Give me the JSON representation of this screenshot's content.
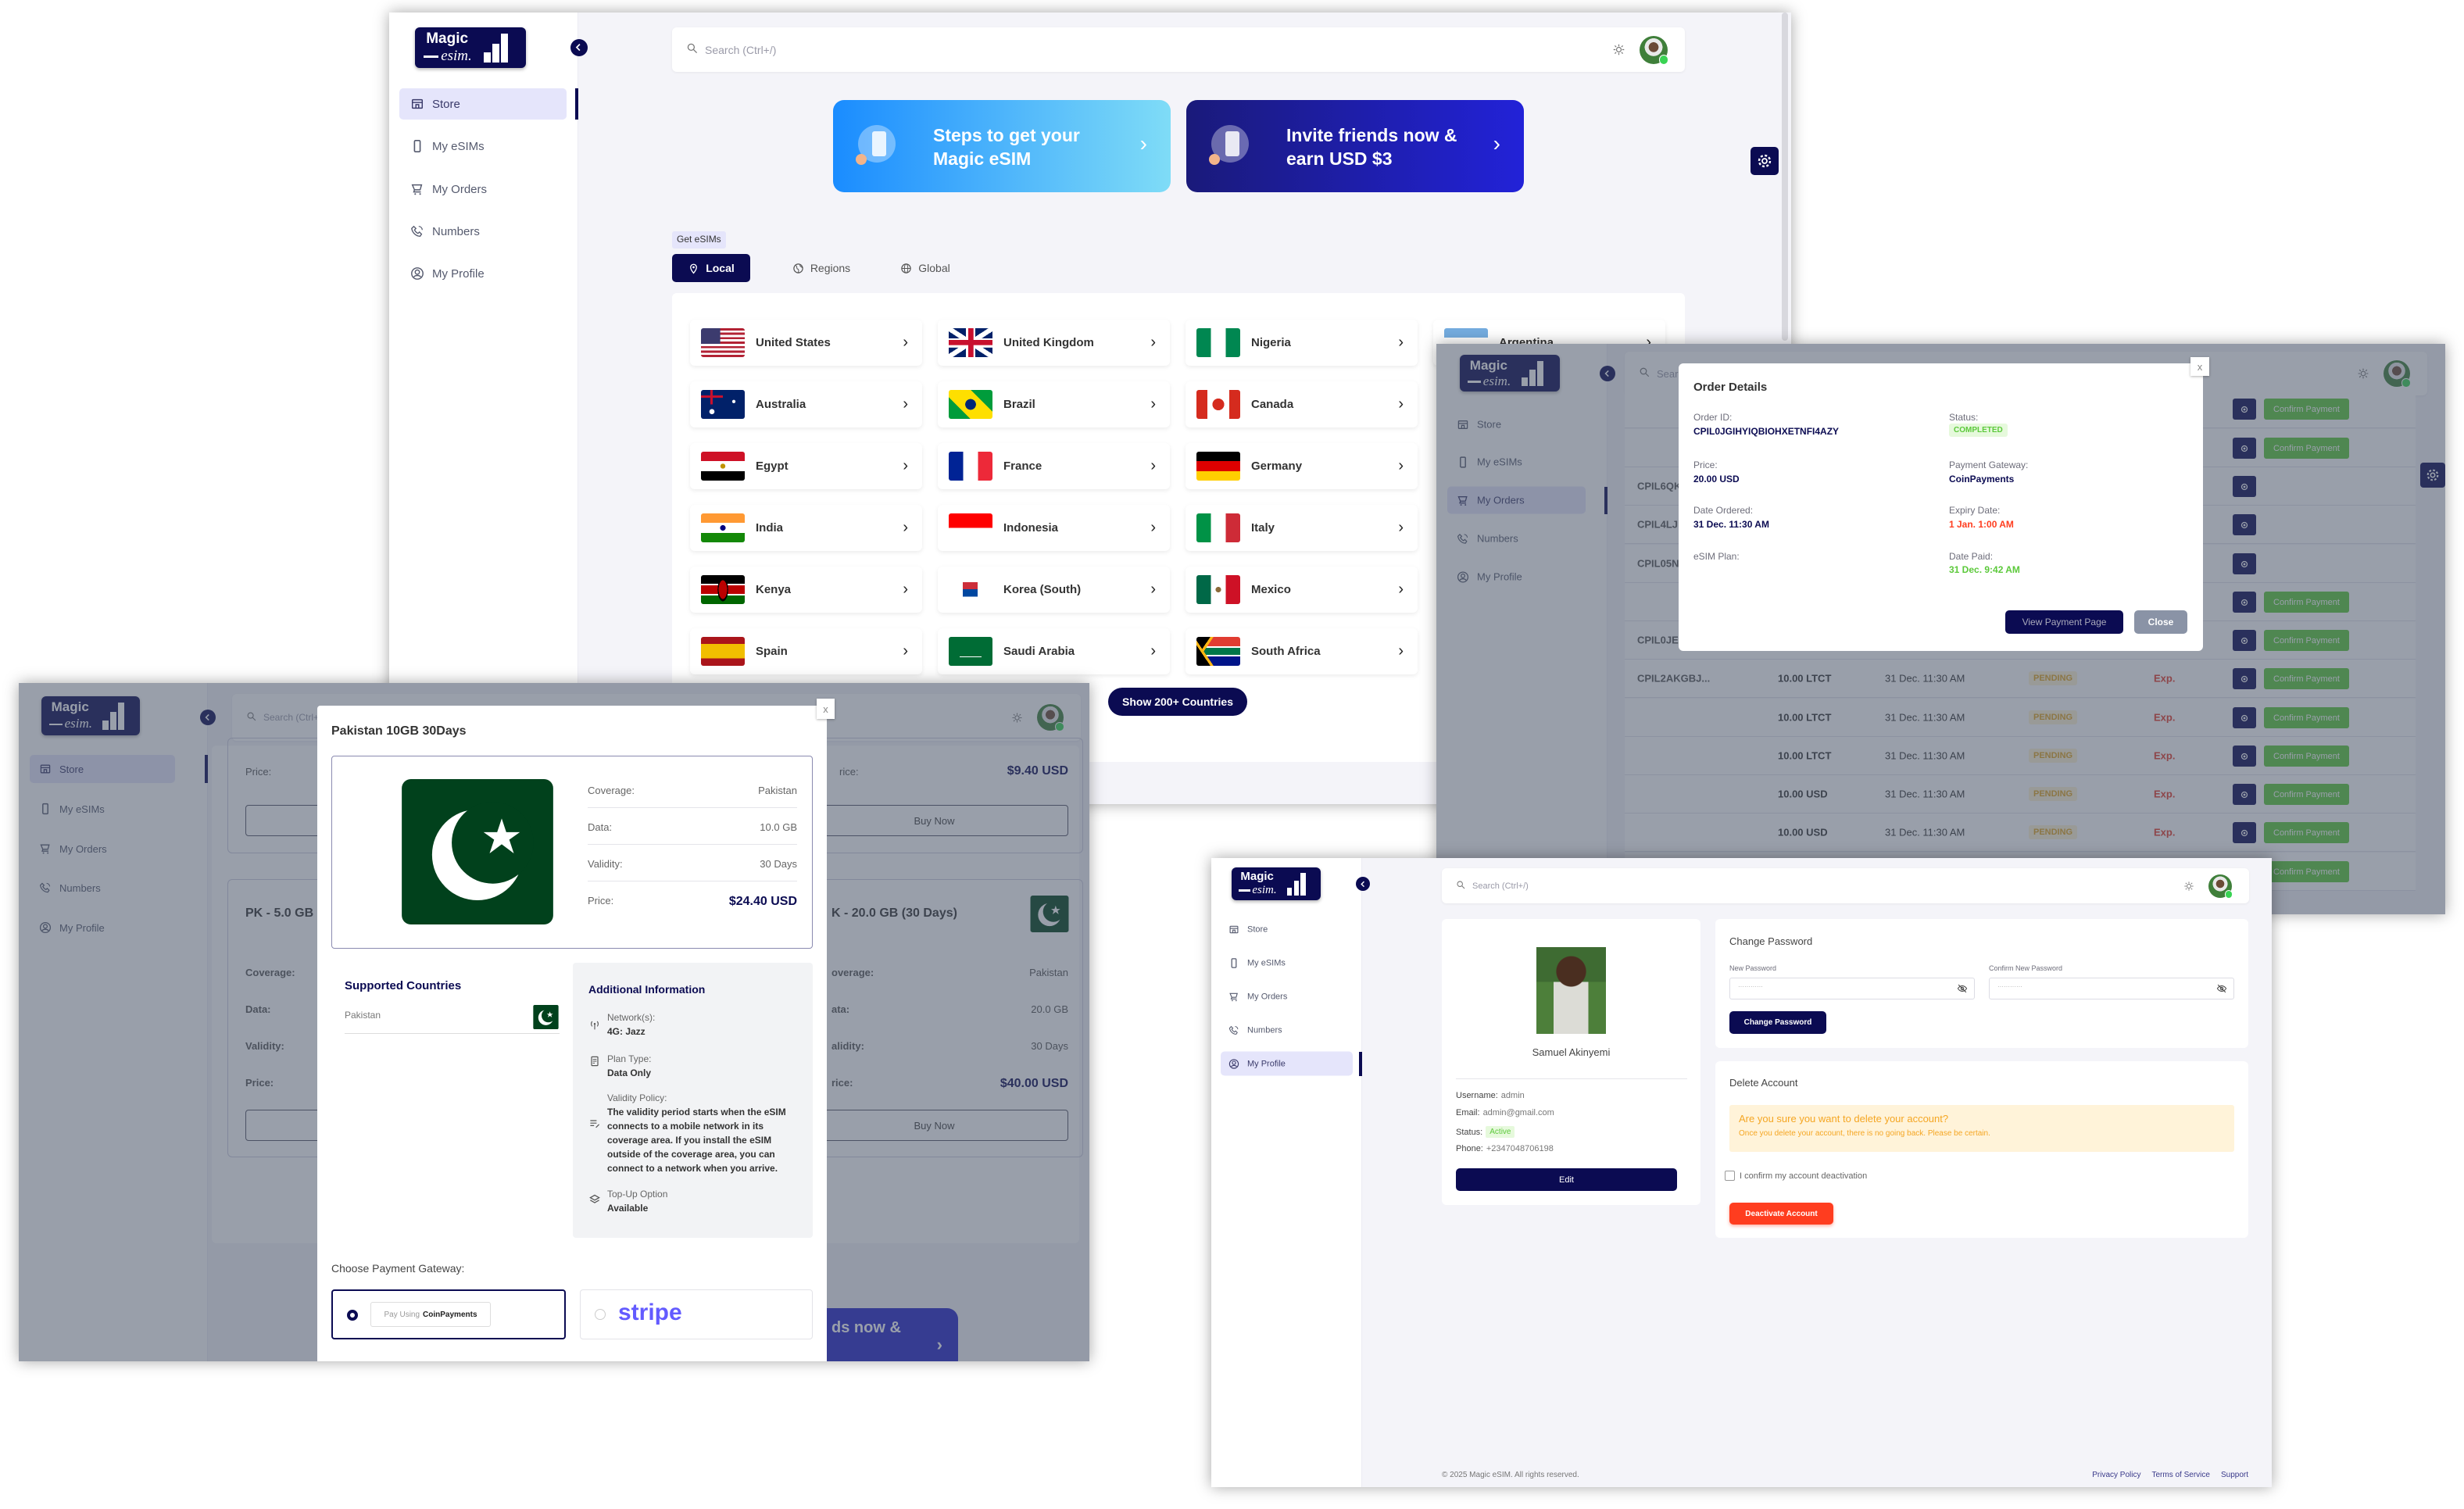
{
  "brand": {
    "line1": "Magic",
    "line2": "esim."
  },
  "nav": [
    {
      "label": "Store",
      "icon": "store-icon"
    },
    {
      "label": "My eSIMs",
      "icon": "sim-phone-icon"
    },
    {
      "label": "My Orders",
      "icon": "cart-icon"
    },
    {
      "label": "Numbers",
      "icon": "phone-call-icon"
    },
    {
      "label": "My Profile",
      "icon": "user-circle-icon"
    }
  ],
  "search_placeholder": "Search (Ctrl+/)",
  "colors": {
    "navy": "#0b0b52",
    "banner_blue": "#2b9bff",
    "banner_indigo": "#1c1ca8",
    "success": "#5cc93b",
    "danger": "#ff3d1f",
    "warning": "#f5a623"
  },
  "store": {
    "banners": [
      {
        "line1": "Steps to get your",
        "line2": "Magic eSIM",
        "icon": "globe-phone-icon"
      },
      {
        "line1": "Invite friends now &",
        "line2": "earn USD $3",
        "icon": "invite-phone-icon"
      }
    ],
    "section_label": "Get eSIMs",
    "tabs": [
      {
        "label": "Local",
        "icon": "pin-icon",
        "active": true
      },
      {
        "label": "Regions",
        "icon": "globe-icon"
      },
      {
        "label": "Global",
        "icon": "globe-grid-icon"
      }
    ],
    "countries": [
      [
        "United States",
        "United Kingdom",
        "Nigeria",
        "Argentina"
      ],
      [
        "Australia",
        "Brazil",
        "Canada"
      ],
      [
        "Egypt",
        "France",
        "Germany"
      ],
      [
        "India",
        "Indonesia",
        "Italy"
      ],
      [
        "Kenya",
        "Korea (South)",
        "Mexico"
      ],
      [
        "Spain",
        "Saudi Arabia",
        "South Africa"
      ]
    ],
    "show_more": "Show 200+ Countries"
  },
  "orders": {
    "confirm_label": "Confirm Payment",
    "rows": [
      {
        "id": "",
        "amount": "",
        "date": "",
        "status": "",
        "expiry": "",
        "confirm": true
      },
      {
        "id": "",
        "amount": "",
        "date": "",
        "status": "",
        "expiry": "",
        "confirm": true
      },
      {
        "id": "CPIL6QK",
        "amount": "",
        "date": "",
        "status": "",
        "expiry": "",
        "confirm": false
      },
      {
        "id": "CPIL4LJ",
        "amount": "",
        "date": "",
        "status": "",
        "expiry": "",
        "confirm": false
      },
      {
        "id": "CPIL05N",
        "amount": "",
        "date": "",
        "status": "",
        "expiry": "",
        "confirm": false
      },
      {
        "id": "",
        "amount": "",
        "date": "",
        "status": "",
        "expiry": "",
        "confirm": true
      },
      {
        "id": "CPIL0JE",
        "amount": "",
        "date": "",
        "status": "",
        "expiry": "",
        "confirm": true
      },
      {
        "id": "CPIL2AKGBJ...",
        "amount": "10.00 LTCT",
        "date": "31 Dec. 11:30 AM",
        "status": "PENDING",
        "expiry": "Exp.",
        "confirm": true
      },
      {
        "id": "",
        "amount": "10.00 LTCT",
        "date": "31 Dec. 11:30 AM",
        "status": "PENDING",
        "expiry": "Exp.",
        "confirm": true
      },
      {
        "id": "",
        "amount": "10.00 LTCT",
        "date": "31 Dec. 11:30 AM",
        "status": "PENDING",
        "expiry": "Exp.",
        "confirm": true
      },
      {
        "id": "",
        "amount": "10.00 USD",
        "date": "31 Dec. 11:30 AM",
        "status": "PENDING",
        "expiry": "Exp.",
        "confirm": true
      },
      {
        "id": "",
        "amount": "10.00 USD",
        "date": "31 Dec. 11:30 AM",
        "status": "PENDING",
        "expiry": "Exp.",
        "confirm": true
      },
      {
        "id": "",
        "amount": "",
        "date": "",
        "status": "",
        "expiry": "",
        "confirm": true
      }
    ],
    "modal": {
      "title": "Order Details",
      "close_x": "x",
      "order_id_label": "Order ID:",
      "order_id": "CPIL0JGIHYIQBIOHXETNFI4AZY",
      "status_label": "Status:",
      "status": "COMPLETED",
      "price_label": "Price:",
      "price": "20.00 USD",
      "gateway_label": "Payment Gateway:",
      "gateway": "CoinPayments",
      "date_ordered_label": "Date Ordered:",
      "date_ordered": "31 Dec. 11:30 AM",
      "expiry_label": "Expiry Date:",
      "expiry": "1 Jan. 1:00 AM",
      "plan_label": "eSIM Plan:",
      "date_paid_label": "Date Paid:",
      "date_paid": "31 Dec. 9:42 AM",
      "view_payment": "View Payment Page",
      "close": "Close"
    }
  },
  "plan": {
    "background": {
      "price_label": "Price:",
      "price_partial_label": "rice:",
      "price_right": "$9.40 USD",
      "buy_now": "Buy Now",
      "left_title": "PK - 5.0 GB (3",
      "right_title": "K - 20.0 GB (30 Days)",
      "labels": [
        "Coverage:",
        "Data:",
        "Validity:",
        "Price:"
      ],
      "partial_labels": [
        "overage:",
        "ata:",
        "alidity:",
        "rice:"
      ],
      "right_values": [
        "Pakistan",
        "20.0 GB",
        "30 Days",
        "$40.00 USD"
      ],
      "banner_partial": "ds now &"
    },
    "modal": {
      "title": "Pakistan 10GB 30Days",
      "close_x": "x",
      "specs": [
        {
          "label": "Coverage:",
          "value": "Pakistan"
        },
        {
          "label": "Data:",
          "value": "10.0 GB"
        },
        {
          "label": "Validity:",
          "value": "30 Days"
        },
        {
          "label": "Price:",
          "value": "$24.40 USD"
        }
      ],
      "supported_title": "Supported Countries",
      "supported": [
        "Pakistan"
      ],
      "additional_title": "Additional Information",
      "additional": [
        {
          "icon": "antenna-icon",
          "label": "Network(s):",
          "value": "4G: Jazz"
        },
        {
          "icon": "document-icon",
          "label": "Plan Type:",
          "value": "Data Only"
        },
        {
          "icon": "list-edit-icon",
          "label": "Validity Policy:",
          "value": "The validity period starts when the eSIM connects to a mobile network in its coverage area. If you install the eSIM outside of the coverage area, you can connect to a network when you arrive."
        },
        {
          "icon": "layers-icon",
          "label": "Top-Up Option",
          "value": "Available"
        }
      ],
      "payment_title": "Choose Payment Gateway:",
      "gateways": [
        {
          "prefix": "Pay Using",
          "name": "CoinPayments",
          "selected": true
        },
        {
          "name": "stripe",
          "selected": false
        }
      ]
    }
  },
  "profile": {
    "name": "Samuel Akinyemi",
    "username_label": "Username:",
    "username": "admin",
    "email_label": "Email:",
    "email": "admin@gmail.com",
    "status_label": "Status:",
    "status": "Active",
    "phone_label": "Phone:",
    "phone": "+2347048706198",
    "edit": "Edit",
    "change_title": "Change Password",
    "new_label": "New Password",
    "new_value": "············",
    "confirm_label": "Confirm New Password",
    "confirm_value": "············",
    "change_button": "Change Password",
    "delete_title": "Delete Account",
    "warn_title": "Are you sure you want to delete your account?",
    "warn_text": "Once you delete your account, there is no going back. Please be certain.",
    "checkbox_label": "I confirm my account deactivation",
    "deactivate": "Deactivate Account"
  },
  "footer": {
    "copyright": "© 2025 Magic eSIM. All rights reserved.",
    "links": [
      "Privacy Policy",
      "Terms of Service",
      "Support"
    ]
  }
}
